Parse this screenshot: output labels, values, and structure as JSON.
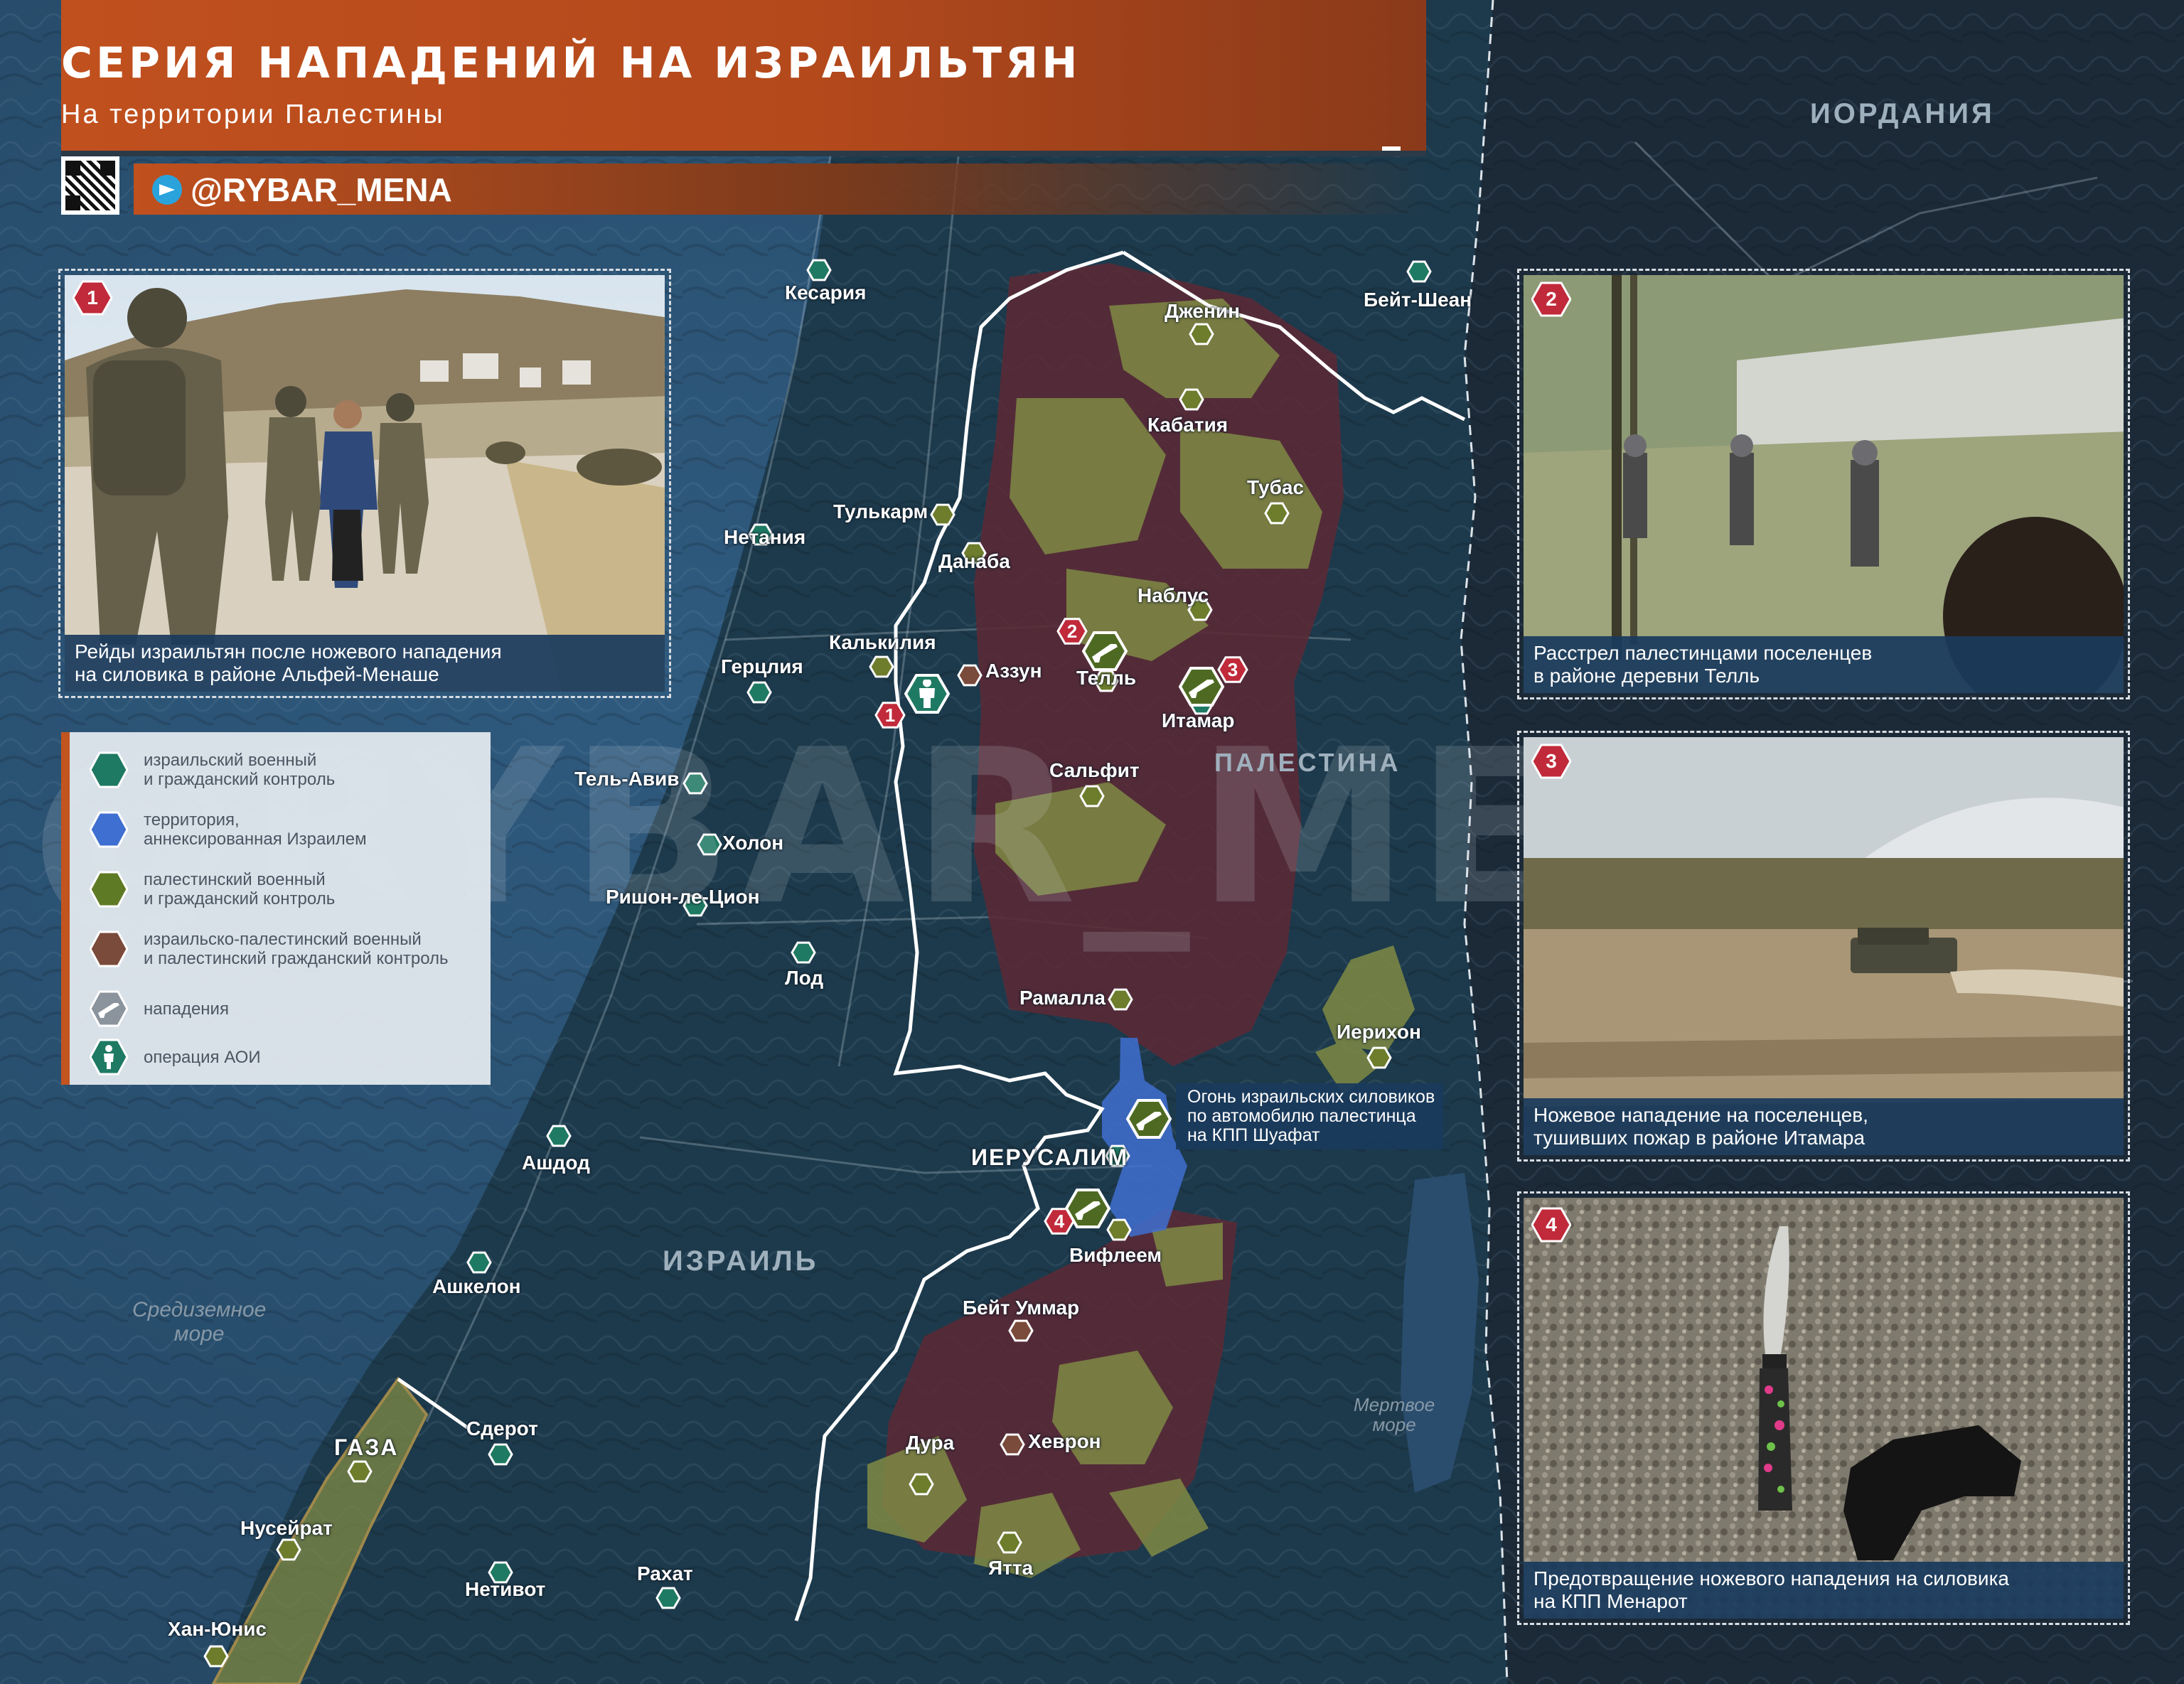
{
  "header": {
    "title": "СЕРИЯ НАПАДЕНИЙ НА ИЗРАИЛЬТЯН",
    "subtitle": "На территории Палестины",
    "channel": "@RYBAR_MENA",
    "qr_icon": "qr-code-icon",
    "telegram_icon": "telegram-icon"
  },
  "watermark": "@RYBAR_MENA",
  "colors": {
    "accent": "#c2541f",
    "sea": "#2a4d6e",
    "land": "#1e3344",
    "israeli_control": "#1f7a63",
    "annexed": "#3f6fd0",
    "palestinian_control": "#7d8a3a",
    "mixed_control": "#6e2f3a",
    "caption_bg": "#1a3a5c",
    "badge": "#c02a3a"
  },
  "legend": [
    {
      "id": "israeli",
      "icon": "israeli-control-hex-icon",
      "lines": [
        "израильский военный",
        "и гражданский контроль"
      ]
    },
    {
      "id": "annexed",
      "icon": "annexed-territory-hex-icon",
      "lines": [
        "территория,",
        "аннексированная Израилем"
      ]
    },
    {
      "id": "palestinian",
      "icon": "palestinian-control-hex-icon",
      "lines": [
        "палестинский военный",
        "и гражданский контроль"
      ]
    },
    {
      "id": "mixed",
      "icon": "mixed-control-hex-icon",
      "lines": [
        "израильско-палестинский военный",
        "и палестинский гражданский контроль"
      ]
    },
    {
      "id": "attacks",
      "icon": "rifle-icon",
      "lines": [
        "нападения"
      ]
    },
    {
      "id": "idf_op",
      "icon": "soldier-icon",
      "lines": [
        "операция АОИ"
      ]
    }
  ],
  "cards": [
    {
      "num": "1",
      "caption": [
        "Рейды израильтян после ножевого нападения",
        "на силовика в районе Альфей-Менаше"
      ]
    },
    {
      "num": "2",
      "caption": [
        "Расстрел палестинцами поселенцев",
        "в районе деревни Телль"
      ]
    },
    {
      "num": "3",
      "caption": [
        "Ножевое нападение на поселенцев,",
        "тушивших пожар в районе Итамара"
      ]
    },
    {
      "num": "4",
      "caption": [
        "Предотвращение ножевого нападения на силовика",
        "на КПП Менарот"
      ]
    }
  ],
  "map": {
    "countries": {
      "jordan": "ИОРДАНИЯ",
      "palestine": "ПАЛЕСТИНА",
      "israel": "ИЗРАИЛЬ"
    },
    "seas": {
      "med": [
        "Средиземное",
        "море"
      ],
      "dead": [
        "Мертвое",
        "море"
      ]
    },
    "callout": [
      "Огонь израильских силовиков",
      "по автомобилю палестинца",
      "на КПП Шуафат"
    ],
    "places": [
      {
        "name": "Кесария",
        "ctrl": "israeli"
      },
      {
        "name": "Бейт-Шеан",
        "ctrl": "israeli"
      },
      {
        "name": "Дженин",
        "ctrl": "palestinian"
      },
      {
        "name": "Кабатия",
        "ctrl": "palestinian"
      },
      {
        "name": "Тубас",
        "ctrl": "palestinian"
      },
      {
        "name": "Тулькарм",
        "ctrl": "palestinian"
      },
      {
        "name": "Нетания",
        "ctrl": "israeli"
      },
      {
        "name": "Данаба",
        "ctrl": "palestinian"
      },
      {
        "name": "Наблус",
        "ctrl": "palestinian"
      },
      {
        "name": "Калькилия",
        "ctrl": "palestinian"
      },
      {
        "name": "Герцлия",
        "ctrl": "israeli"
      },
      {
        "name": "Аззун",
        "ctrl": "mixed"
      },
      {
        "name": "Телль",
        "ctrl": "palestinian"
      },
      {
        "name": "Итамар",
        "ctrl": "israeli"
      },
      {
        "name": "Тель-Авив",
        "ctrl": "israeli"
      },
      {
        "name": "Сальфит",
        "ctrl": "palestinian"
      },
      {
        "name": "Холон",
        "ctrl": "israeli"
      },
      {
        "name": "Ришон-ле-Цион",
        "ctrl": "israeli"
      },
      {
        "name": "Лод",
        "ctrl": "israeli"
      },
      {
        "name": "Рамалла",
        "ctrl": "palestinian"
      },
      {
        "name": "Иерихон",
        "ctrl": "palestinian"
      },
      {
        "name": "ИЕРУСАЛИМ",
        "ctrl": "israeli"
      },
      {
        "name": "Ашдод",
        "ctrl": "israeli"
      },
      {
        "name": "Вифлеем",
        "ctrl": "palestinian"
      },
      {
        "name": "Ашкелон",
        "ctrl": "israeli"
      },
      {
        "name": "Бейт Уммар",
        "ctrl": "mixed"
      },
      {
        "name": "Сдерот",
        "ctrl": "israeli"
      },
      {
        "name": "ГАЗА",
        "ctrl": "palestinian"
      },
      {
        "name": "Дура",
        "ctrl": "palestinian"
      },
      {
        "name": "Хеврон",
        "ctrl": "mixed"
      },
      {
        "name": "Нусейрат",
        "ctrl": "palestinian"
      },
      {
        "name": "Ятта",
        "ctrl": "palestinian"
      },
      {
        "name": "Рахат",
        "ctrl": "israeli"
      },
      {
        "name": "Нетивот",
        "ctrl": "israeli"
      },
      {
        "name": "Хан-Юнис",
        "ctrl": "palestinian"
      }
    ],
    "markers": [
      {
        "num": "1",
        "type": "idf_op"
      },
      {
        "num": "2",
        "type": "attack"
      },
      {
        "num": "3",
        "type": "attack"
      },
      {
        "num": "4",
        "type": "attack"
      },
      {
        "num": "",
        "type": "attack"
      }
    ]
  }
}
